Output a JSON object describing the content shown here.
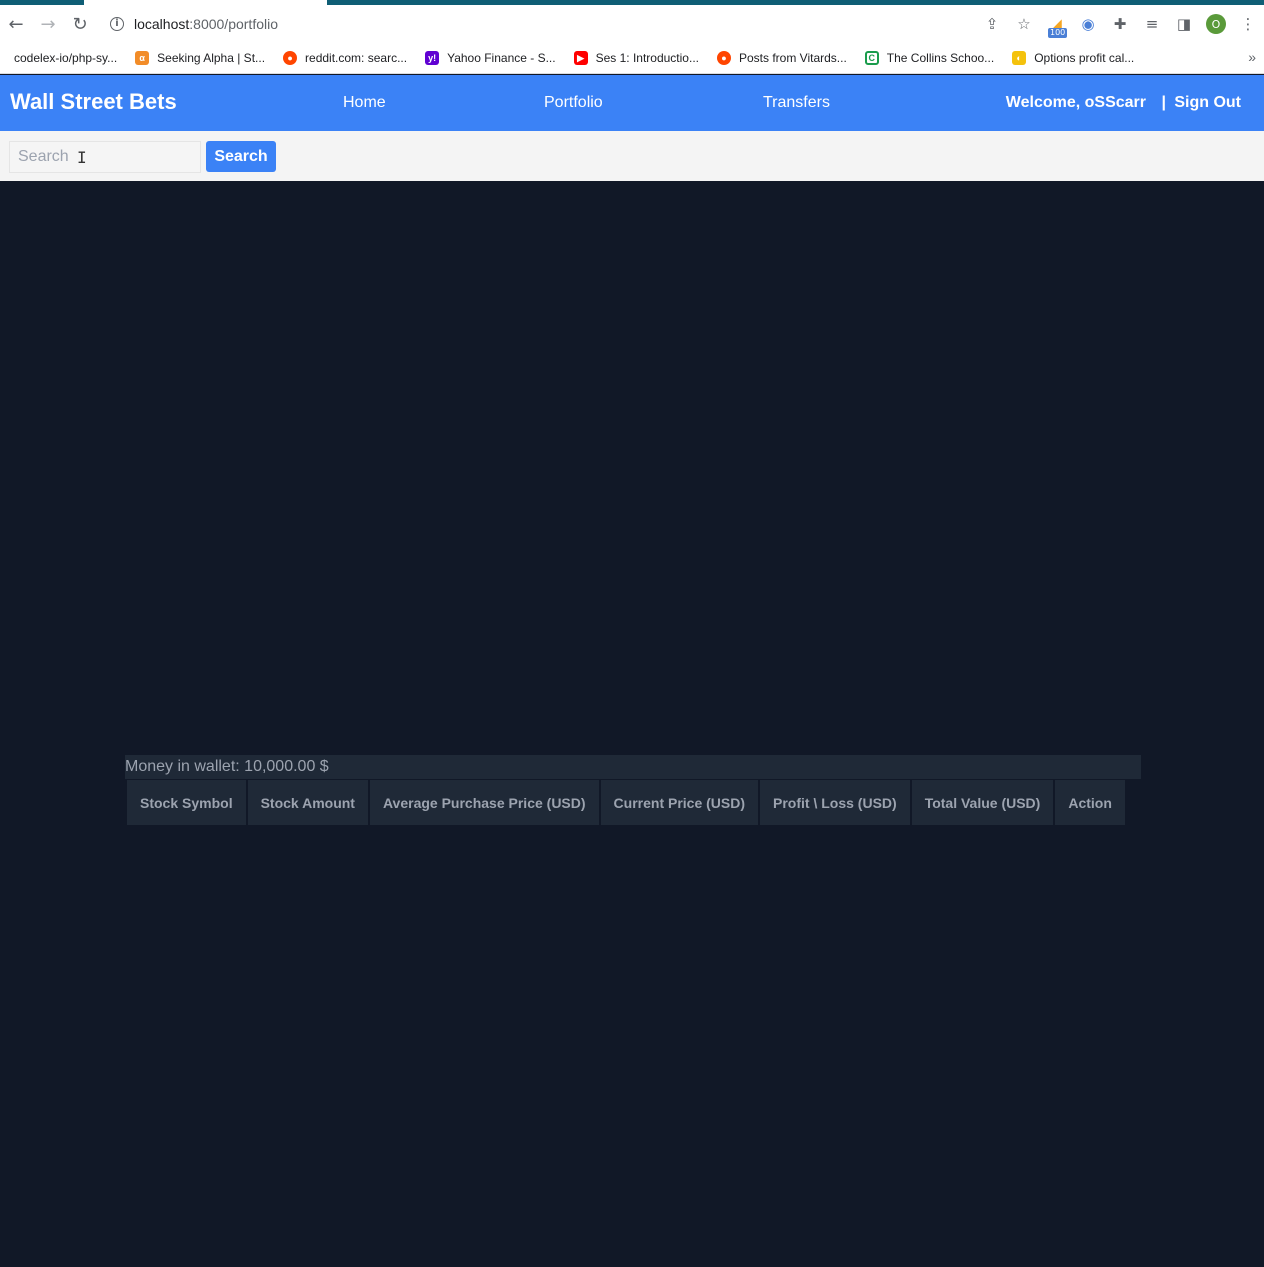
{
  "browser": {
    "url_host": "localhost",
    "url_path": ":8000/portfolio",
    "bookmarks": [
      {
        "label": "codelex-io/php-sy...",
        "color": "#24292f"
      },
      {
        "label": "Seeking Alpha | St...",
        "color": "#f28c28"
      },
      {
        "label": "reddit.com: searc...",
        "color": "#ff4500"
      },
      {
        "label": "Yahoo Finance - S...",
        "color": "#6001d2"
      },
      {
        "label": "Ses 1: Introductio...",
        "color": "#ff0000"
      },
      {
        "label": "Posts from Vitards...",
        "color": "#ff4500"
      },
      {
        "label": "The Collins Schoo...",
        "color": "#1a9c4c"
      },
      {
        "label": "Options profit cal...",
        "color": "#d93025"
      }
    ],
    "badge": "100",
    "profile_initial": "O"
  },
  "header": {
    "brand": "Wall Street Bets",
    "nav": [
      "Home",
      "Portfolio",
      "Transfers"
    ],
    "welcome": "Welcome, oSScarr",
    "separator": "|",
    "sign_out": "Sign Out",
    "color": "#3b82f6"
  },
  "search": {
    "placeholder": "Search",
    "button": "Search"
  },
  "wallet": {
    "text": "Money in wallet: 10,000.00 $"
  },
  "table": {
    "headers": [
      "Stock Symbol",
      "Stock Amount",
      "Average Purchase Price (USD)",
      "Current Price (USD)",
      "Profit \\ Loss (USD)",
      "Total Value (USD)",
      "Action"
    ]
  }
}
